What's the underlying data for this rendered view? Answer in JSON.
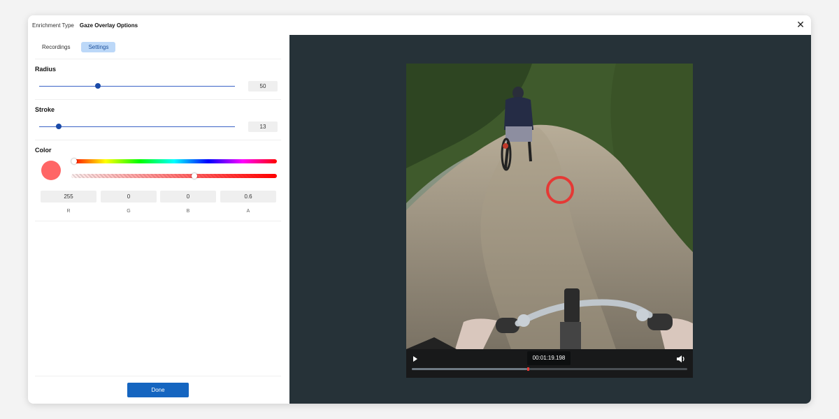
{
  "header": {
    "label": "Enrichment Type",
    "value": "Gaze Overlay Options",
    "close_icon": "close-icon"
  },
  "tabs": [
    {
      "label": "Recordings",
      "active": false
    },
    {
      "label": "Settings",
      "active": true
    }
  ],
  "radius": {
    "title": "Radius",
    "value": "50",
    "slider_fraction": 0.3
  },
  "stroke": {
    "title": "Stroke",
    "value": "13",
    "slider_fraction": 0.1
  },
  "color": {
    "title": "Color",
    "swatch": "#ff0000",
    "hue_fraction": 0.0,
    "alpha_fraction": 0.6,
    "fields": [
      {
        "value": "255",
        "label": "R"
      },
      {
        "value": "0",
        "label": "G"
      },
      {
        "value": "0",
        "label": "B"
      },
      {
        "value": "0.6",
        "label": "A"
      }
    ]
  },
  "footer": {
    "done_label": "Done"
  },
  "player": {
    "timestamp": "00:01:19.198",
    "progress_fraction": 0.42,
    "play_icon": "play-icon",
    "volume_icon": "volume-icon",
    "gaze_color": "#e53935"
  }
}
